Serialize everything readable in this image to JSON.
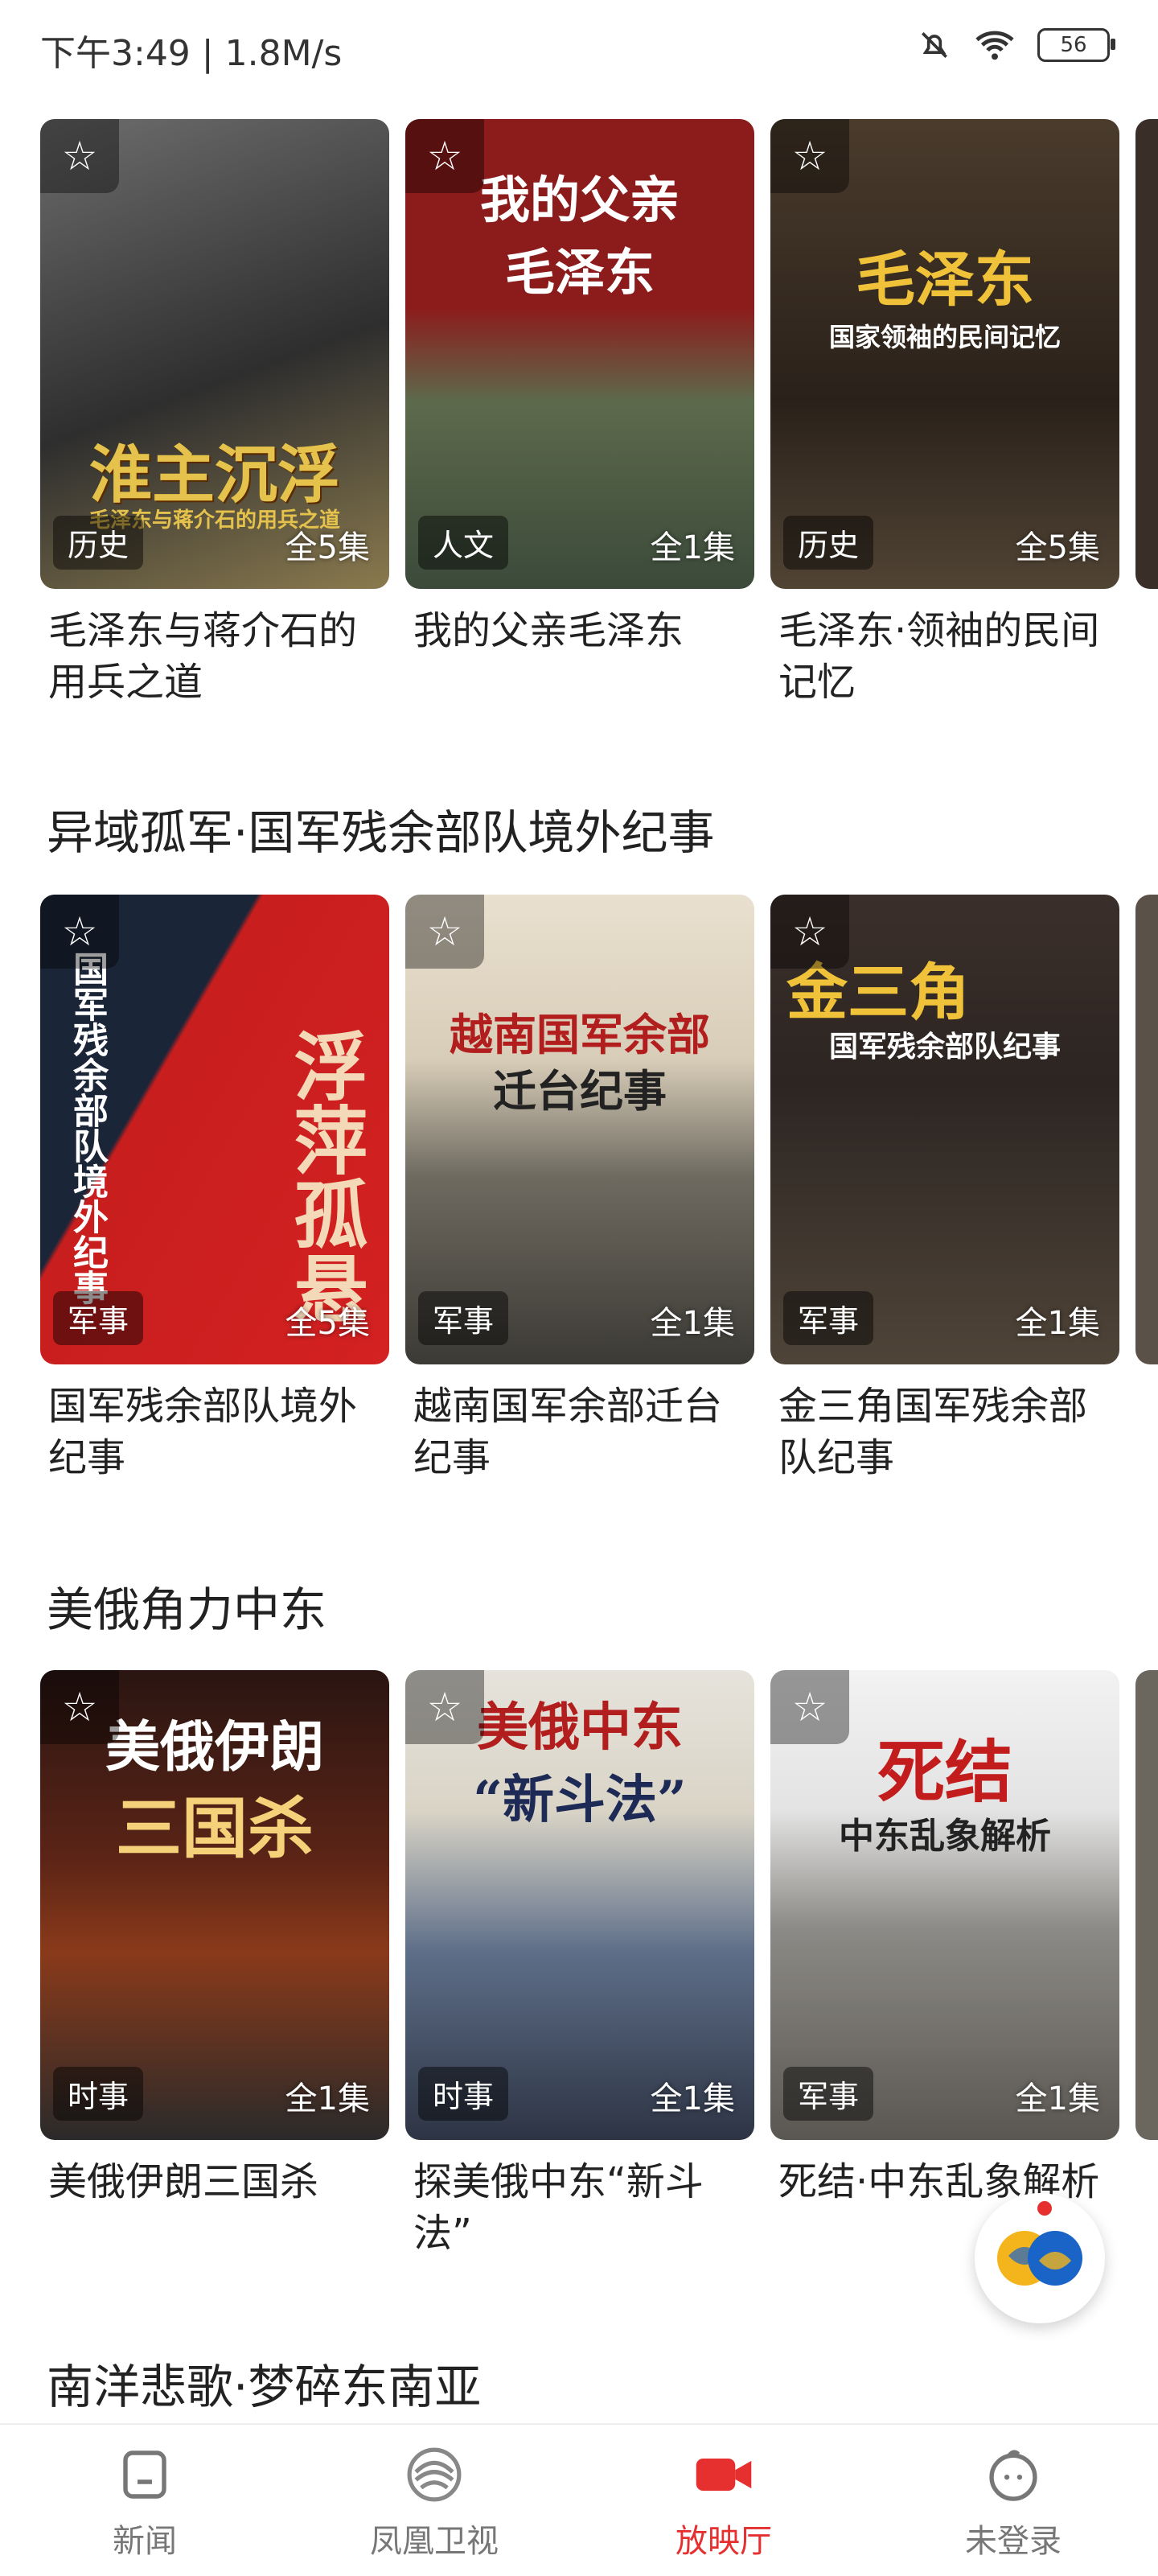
{
  "status_bar": {
    "time": "下午3:49 | 1.8M/s",
    "battery": "56"
  },
  "sections": [
    {
      "title": "",
      "items": [
        {
          "title": "毛泽东与蒋介石的用兵之道",
          "tag": "历史",
          "count": "全5集"
        },
        {
          "title": "我的父亲毛泽东",
          "tag": "人文",
          "count": "全1集"
        },
        {
          "title": "毛泽东·领袖的民间记忆",
          "tag": "历史",
          "count": "全5集"
        }
      ]
    },
    {
      "title": "异域孤军·国军残余部队境外纪事",
      "items": [
        {
          "title": "国军残余部队境外纪事",
          "tag": "军事",
          "count": "全5集"
        },
        {
          "title": "越南国军余部迁台纪事",
          "tag": "军事",
          "count": "全1集"
        },
        {
          "title": "金三角国军残余部队纪事",
          "tag": "军事",
          "count": "全1集"
        }
      ]
    },
    {
      "title": "美俄角力中东",
      "items": [
        {
          "title": "美俄伊朗三国杀",
          "tag": "时事",
          "count": "全1集"
        },
        {
          "title": "探美俄中东“新斗法”",
          "tag": "时事",
          "count": "全1集"
        },
        {
          "title": "死结·中东乱象解析",
          "tag": "军事",
          "count": "全1集"
        }
      ]
    },
    {
      "title": "南洋悲歌·梦碎东南亚"
    }
  ],
  "posters": {
    "p1": "淮主沉浮",
    "p1_sub": "毛泽东与蒋介石的用兵之道",
    "p2": "我的父亲",
    "p2b": "毛泽东",
    "p3": "毛泽东",
    "p3_sub": "国家领袖的民间记忆",
    "p4": "浮萍孤悬",
    "p4_side": "国军残余部队境外纪事",
    "p5": "越南国军余部",
    "p5b": "迁台纪事",
    "p6": "金三角",
    "p6_sub": "国军残余部队纪事",
    "p7": "美俄伊朗",
    "p7b": "三国杀",
    "p8": "美俄中东",
    "p8b": "“新斗法”",
    "p9": "死结",
    "p9_sub": "中东乱象解析"
  },
  "tabbar": [
    {
      "label": "新闻",
      "icon": "news-icon"
    },
    {
      "label": "凤凰卫视",
      "icon": "phoenix-logo-icon"
    },
    {
      "label": "放映厅",
      "icon": "video-camera-icon",
      "active": true
    },
    {
      "label": "未登录",
      "icon": "user-avatar-icon"
    }
  ],
  "colors": {
    "accent": "#e62f2f"
  }
}
